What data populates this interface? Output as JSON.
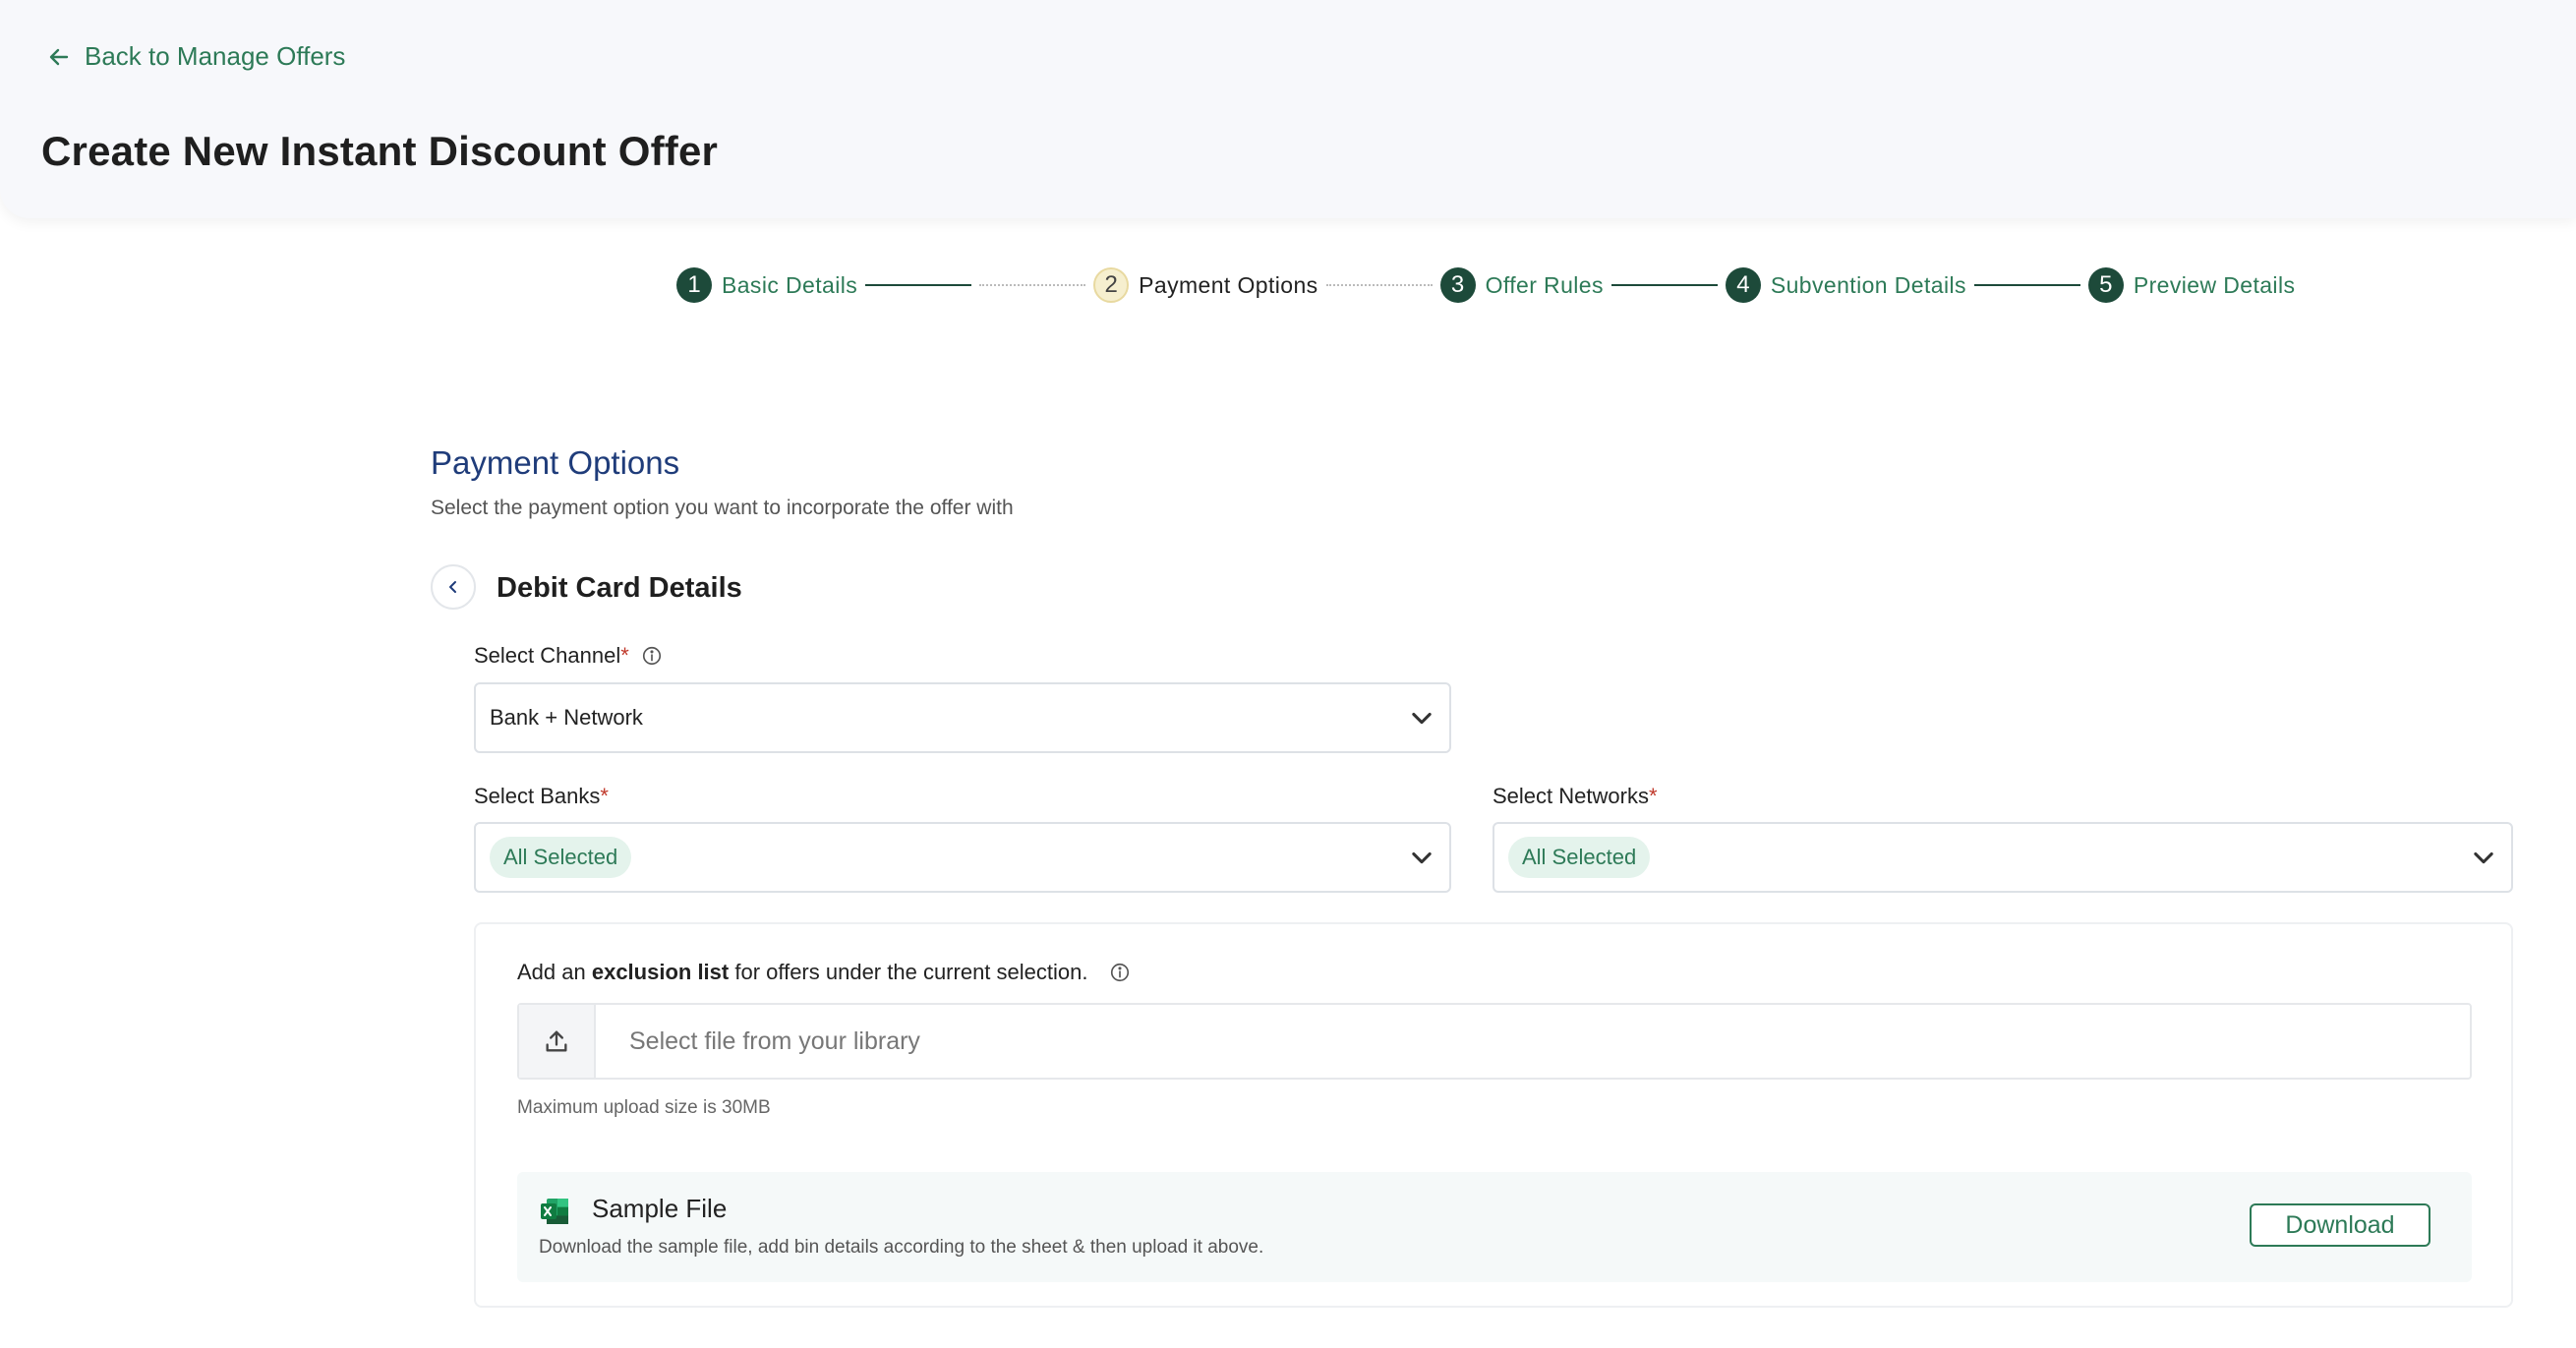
{
  "header": {
    "back_label": "Back to Manage Offers",
    "title": "Create New Instant Discount Offer"
  },
  "stepper": {
    "steps": [
      {
        "num": "1",
        "label": "Basic Details",
        "state": "done"
      },
      {
        "num": "2",
        "label": "Payment Options",
        "state": "active"
      },
      {
        "num": "3",
        "label": "Offer Rules",
        "state": "done"
      },
      {
        "num": "4",
        "label": "Subvention Details",
        "state": "done"
      },
      {
        "num": "5",
        "label": "Preview Details",
        "state": "done"
      }
    ]
  },
  "section": {
    "title": "Payment Options",
    "subtitle": "Select the payment option you want to incorporate the offer with",
    "card_title": "Debit Card Details"
  },
  "fields": {
    "channel": {
      "label": "Select Channel",
      "required": "*",
      "value": "Bank + Network"
    },
    "banks": {
      "label": "Select Banks",
      "required": "*",
      "value": "All Selected"
    },
    "networks": {
      "label": "Select Networks",
      "required": "*",
      "value": "All Selected"
    }
  },
  "exclusion": {
    "text_prefix": "Add an ",
    "text_bold": "exclusion list",
    "text_suffix": " for offers under the current selection.",
    "upload_placeholder": "Select file from your library",
    "upload_hint": "Maximum upload size is 30MB"
  },
  "sample": {
    "title": "Sample File",
    "description": "Download the sample file, add bin details according to the sheet & then upload it above.",
    "download_label": "Download"
  },
  "colors": {
    "brand_green": "#2d7a57",
    "dark_green": "#1d4a3a",
    "title_blue": "#1f3c7a"
  }
}
